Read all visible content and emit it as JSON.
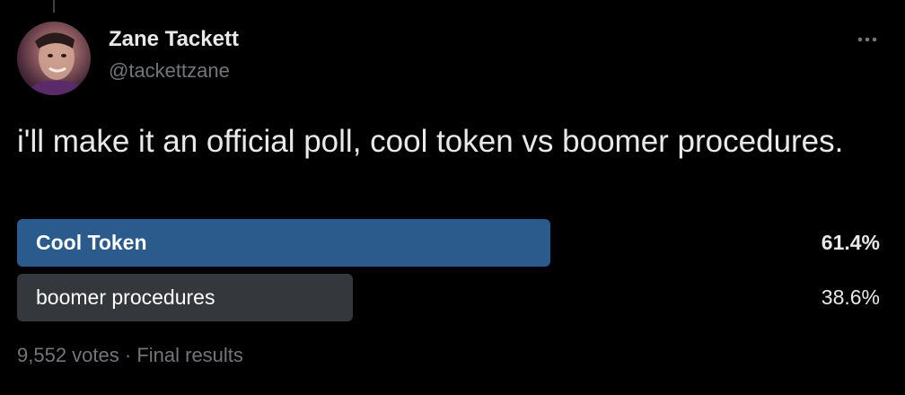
{
  "author": {
    "display_name": "Zane Tackett",
    "handle": "@tackettzane"
  },
  "tweet": {
    "text": "i'll make it an official poll, cool token vs boomer procedures."
  },
  "poll": {
    "options": [
      {
        "label": "Cool Token",
        "percent_text": "61.4%",
        "percent": 61.4,
        "winner": true,
        "bar_color": "#2b5a8c"
      },
      {
        "label": "boomer procedures",
        "percent_text": "38.6%",
        "percent": 38.6,
        "winner": false,
        "bar_color": "#34373b"
      }
    ],
    "votes": "9,552 votes",
    "separator": "·",
    "status": "Final results"
  },
  "colors": {
    "background": "#000000",
    "primary_text": "#e7e9ea",
    "secondary_text": "#71767b"
  },
  "icons": {
    "more": "more-horizontal-icon",
    "avatar": "user-avatar-photo"
  }
}
